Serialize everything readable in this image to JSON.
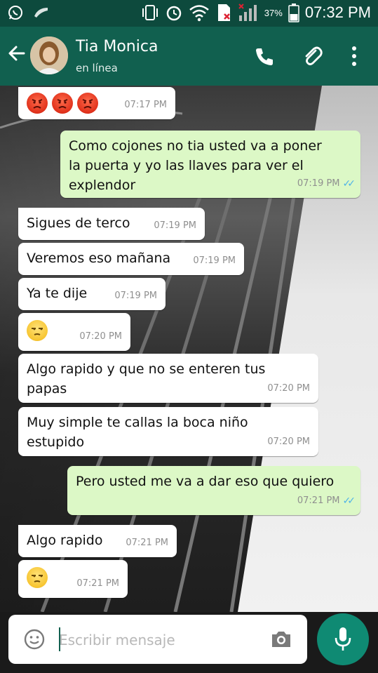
{
  "status_bar": {
    "battery": "37%",
    "time": "07:32 PM"
  },
  "header": {
    "contact_name": "Tia Monica",
    "contact_status": "en línea"
  },
  "messages": [
    {
      "dir": "in",
      "emoji": "angry x3",
      "time": "07:17 PM"
    },
    {
      "dir": "out",
      "lines": [
        "Como cojones no tia usted va a poner",
        "la puerta y yo las llaves para ver el",
        "explendor"
      ],
      "time": "07:19 PM",
      "status": "read"
    },
    {
      "dir": "in",
      "lines": [
        "Sigues de terco"
      ],
      "time": "07:19 PM"
    },
    {
      "dir": "in",
      "lines": [
        "Veremos eso mañana"
      ],
      "time": "07:19 PM"
    },
    {
      "dir": "in",
      "lines": [
        "Ya te dije"
      ],
      "time": "07:19 PM"
    },
    {
      "dir": "in",
      "emoji": "unamused",
      "time": "07:20 PM"
    },
    {
      "dir": "in",
      "lines": [
        "Algo rapido y que no se enteren tus",
        "papas"
      ],
      "time": "07:20 PM"
    },
    {
      "dir": "in",
      "lines": [
        "Muy simple te callas la boca niño",
        "estupido"
      ],
      "time": "07:20 PM"
    },
    {
      "dir": "out",
      "lines": [
        "Pero usted me va a dar eso que quiero"
      ],
      "time": "07:21 PM",
      "status": "read"
    },
    {
      "dir": "in",
      "lines": [
        "Algo rapido"
      ],
      "time": "07:21 PM"
    },
    {
      "dir": "in",
      "emoji": "unamused",
      "time": "07:21 PM"
    }
  ],
  "composer": {
    "placeholder": "Escribir mensaje"
  },
  "colors": {
    "header": "#11604f",
    "status_bar": "#0d4a3d",
    "outgoing_bubble": "#dcf8c6",
    "incoming_bubble": "#ffffff",
    "read_ticks": "#4fb3e8",
    "mic_button": "#0f8a73"
  },
  "icons": [
    "whatsapp-icon",
    "silent-icon",
    "vibrate-icon",
    "alarm-icon",
    "wifi-icon",
    "no-sim-icon",
    "signal-icon",
    "battery-icon",
    "back-arrow-icon",
    "call-icon",
    "attach-icon",
    "more-vert-icon",
    "emoji-icon",
    "camera-icon",
    "mic-icon"
  ]
}
